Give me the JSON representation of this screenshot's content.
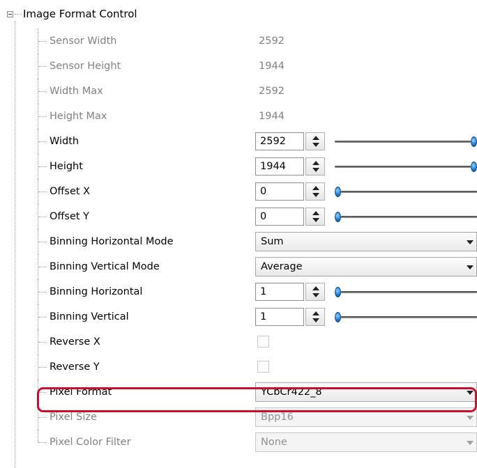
{
  "tree": {
    "root_label": "Image Format Control",
    "expander_icon": "minus-box-icon",
    "properties": [
      {
        "id": "sensor-width",
        "label": "Sensor Width",
        "kind": "readonly",
        "value": "2592"
      },
      {
        "id": "sensor-height",
        "label": "Sensor Height",
        "kind": "readonly",
        "value": "1944"
      },
      {
        "id": "width-max",
        "label": "Width Max",
        "kind": "readonly",
        "value": "2592"
      },
      {
        "id": "height-max",
        "label": "Height Max",
        "kind": "readonly",
        "value": "1944"
      },
      {
        "id": "width",
        "label": "Width",
        "kind": "spin-slider",
        "value": "2592",
        "slider_level": 1.0
      },
      {
        "id": "height",
        "label": "Height",
        "kind": "spin-slider",
        "value": "1944",
        "slider_level": 1.0
      },
      {
        "id": "offset-x",
        "label": "Offset X",
        "kind": "spin-slider",
        "value": "0",
        "slider_level": 0.0
      },
      {
        "id": "offset-y",
        "label": "Offset Y",
        "kind": "spin-slider",
        "value": "0",
        "slider_level": 0.0
      },
      {
        "id": "binning-horizontal-mode",
        "label": "Binning Horizontal Mode",
        "kind": "combo",
        "value": "Sum",
        "enabled": true
      },
      {
        "id": "binning-vertical-mode",
        "label": "Binning Vertical Mode",
        "kind": "combo",
        "value": "Average",
        "enabled": true
      },
      {
        "id": "binning-horizontal",
        "label": "Binning Horizontal",
        "kind": "spin-slider",
        "value": "1",
        "slider_level": 0.0
      },
      {
        "id": "binning-vertical",
        "label": "Binning Vertical",
        "kind": "spin-slider",
        "value": "1",
        "slider_level": 0.0
      },
      {
        "id": "reverse-x",
        "label": "Reverse X",
        "kind": "checkbox",
        "checked": false
      },
      {
        "id": "reverse-y",
        "label": "Reverse Y",
        "kind": "checkbox",
        "checked": false
      },
      {
        "id": "pixel-format",
        "label": "Pixel Format",
        "kind": "combo",
        "value": "YCbCr422_8",
        "enabled": true,
        "highlighted": true
      },
      {
        "id": "pixel-size",
        "label": "Pixel Size",
        "kind": "combo",
        "value": "Bpp16",
        "enabled": false
      },
      {
        "id": "pixel-color-filter",
        "label": "Pixel Color Filter",
        "kind": "combo",
        "value": "None",
        "enabled": false
      }
    ]
  },
  "colors": {
    "highlight_border": "#c8102e",
    "slider_knob": "#2a7fd0",
    "readonly_text": "#808080"
  }
}
